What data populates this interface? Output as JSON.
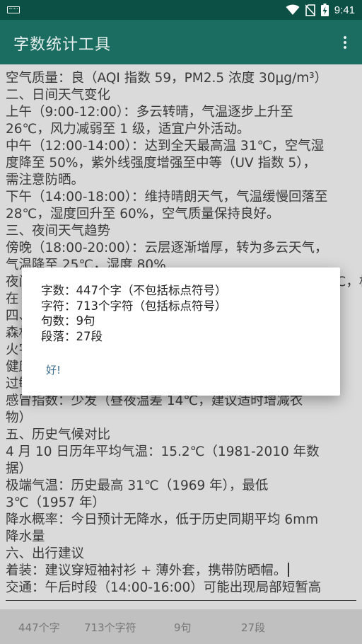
{
  "status_bar": {
    "time": "9:41"
  },
  "app_bar": {
    "title": "字数统计工具",
    "overflow_icon": "more-vert-icon"
  },
  "editor": {
    "lines": [
      "空气质量：良（AQI 指数 59，PM2.5 浓度 30μg/m³）",
      "二、日间天气变化",
      "上午（9:00-12:00）：多云转晴，气温逐步上升至",
      "26℃，风力减弱至 1 级，适宜户外活动。",
      "中午（12:00-14:00）：达到全天最高温 31℃，空气湿",
      "度降至 50%，紫外线强度增强至中等（UV 指数 5），",
      "需注意防晒。",
      "下午（14:00-18:00）：维持晴朗天气，气温缓慢回落至",
      "28℃，湿度回升至 60%，空气质量保持良好。",
      "三、夜间天气趋势",
      "傍晚（18:00-20:00）：云层逐渐增厚，转为多云天气，",
      "气温降至 25℃，湿度 80%",
      "夜间（20:00-次日 6:00）：多云间阴，气温最低降至 21℃，相对湿度维持",
      "在",
      "四、",
      "森林                                                                         用",
      "火字",
      "健康",
      "过敏",
      "感冒指数：少发（昼夜温差 14℃，建议适时增减衣",
      "物）",
      "五、历史气候对比",
      "4 月 10 日历年平均气温：15.2℃（1981-2010 年数",
      "据）",
      "极端气温：历史最高 31℃（1969 年），最低",
      "3℃（1957 年）",
      "降水概率：今日预计无降水，低于历史同期平均 6mm",
      "降水量",
      "六、出行建议",
      "着装：建议穿短袖衬衫 + 薄外套，携带防晒帽。",
      "交通：午后时段（14:00-16:00）可能出现局部短暂高"
    ]
  },
  "bottom_bar": {
    "chars_no_punct": "447个字",
    "chars_with_punct": "713个字符",
    "sentences": "9句",
    "paragraphs": "27段"
  },
  "dialog": {
    "line_words": "字数：447个字（不包括标点符号）",
    "line_chars": "字符：713个字符（包括标点符号）",
    "line_sentences": "句数：9句",
    "line_paragraphs": "段落：27段",
    "ok_label": "好!"
  },
  "colors": {
    "status_bar": "#0c4f44",
    "app_bar": "#1b6d62",
    "accent_button": "#3f6f8f"
  }
}
